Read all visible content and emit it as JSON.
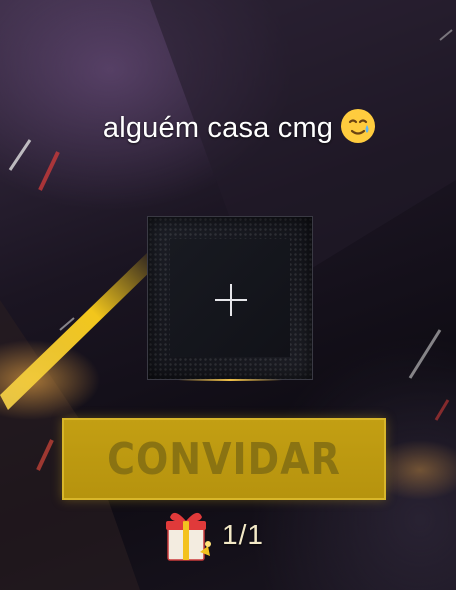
{
  "caption": {
    "text": "alguém casa cmg"
  },
  "invite_button": {
    "label": "CONVIDAR"
  },
  "reward": {
    "count": "1/1"
  },
  "icons": {
    "caption_emoji": "smiling-face-with-tear-icon",
    "slot": "plus-icon",
    "reward": "gift-icon"
  },
  "colors": {
    "button_fill": "#c39f13",
    "button_text": "#8a7312",
    "accent_streak": "#f2c61c"
  }
}
